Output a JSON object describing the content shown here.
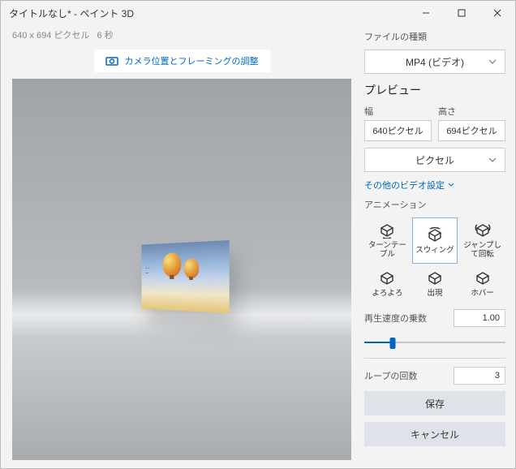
{
  "title": "タイトルなし* - ペイント 3D",
  "meta": {
    "dims": "640 x 694 ピクセル",
    "duration": "6 秒"
  },
  "camera_button": "カメラ位置とフレーミングの調整",
  "filetype": {
    "label": "ファイルの種類",
    "value": "MP4 (ビデオ)"
  },
  "preview_label": "プレビュー",
  "width": {
    "label": "幅",
    "value": "640ピクセル"
  },
  "height": {
    "label": "高さ",
    "value": "694ピクセル"
  },
  "unit": "ピクセル",
  "more_video": "その他のビデオ設定",
  "animation_label": "アニメーション",
  "animations": [
    {
      "name": "turntable",
      "label": "ターンテーブル"
    },
    {
      "name": "swing",
      "label": "スウィング",
      "selected": true
    },
    {
      "name": "jump-rotate",
      "label": "ジャンプして回転"
    },
    {
      "name": "wobble",
      "label": "よろよろ"
    },
    {
      "name": "appear",
      "label": "出現"
    },
    {
      "name": "hover",
      "label": "ホバー"
    }
  ],
  "speed": {
    "label": "再生速度の乗数",
    "value": "1.00"
  },
  "loops": {
    "label": "ループの回数",
    "value": "3"
  },
  "save": "保存",
  "cancel": "キャンセル"
}
